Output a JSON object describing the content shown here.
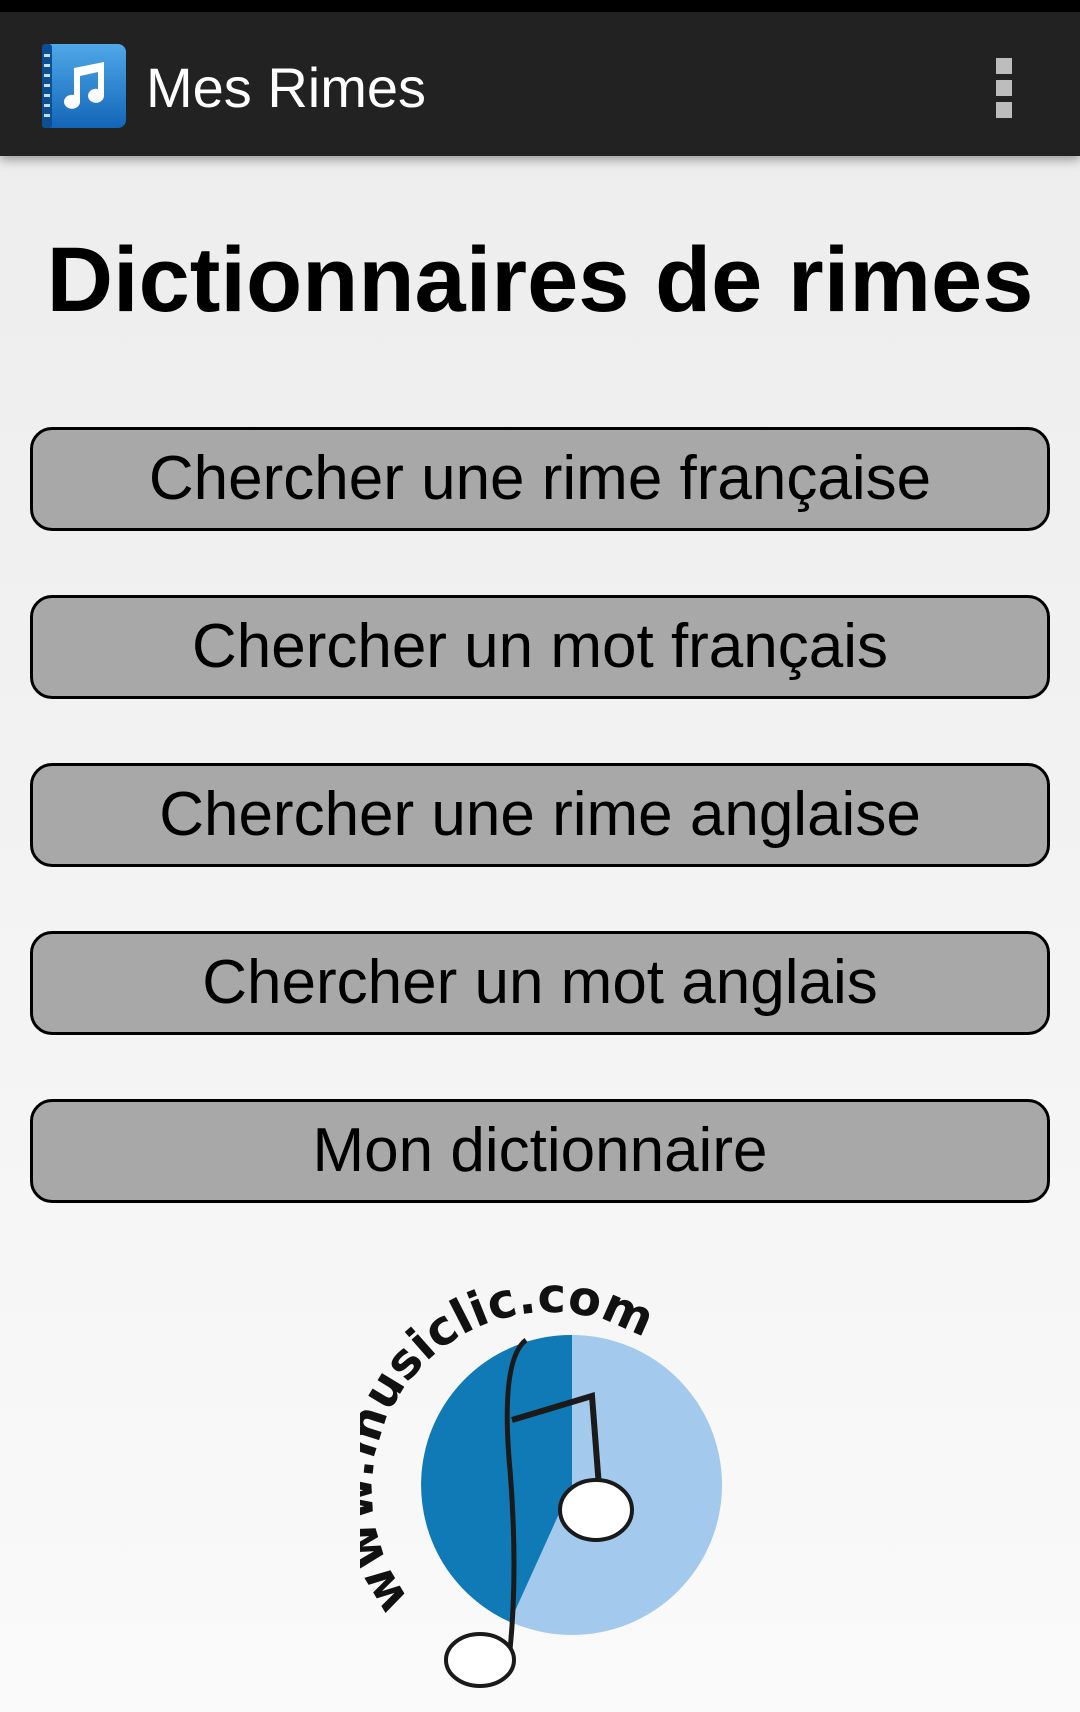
{
  "status_bar": {},
  "action_bar": {
    "app_icon": "music-note-notebook-icon",
    "title": "Mes Rimes",
    "overflow_icon": "overflow-menu-icon"
  },
  "main": {
    "title": "Dictionnaires de rimes",
    "buttons": [
      {
        "label": "Chercher une rime française"
      },
      {
        "label": "Chercher un mot français"
      },
      {
        "label": "Chercher une rime anglaise"
      },
      {
        "label": "Chercher un mot anglais"
      },
      {
        "label": "Mon dictionnaire"
      }
    ]
  },
  "logo": {
    "text": "www.musiclic.com",
    "icon": "musiclic-logo"
  },
  "colors": {
    "action_bar": "#222222",
    "button_fill": "#a8a8a8",
    "logo_dark_blue": "#0f7ab5",
    "logo_light_blue": "#a3c9ec"
  }
}
